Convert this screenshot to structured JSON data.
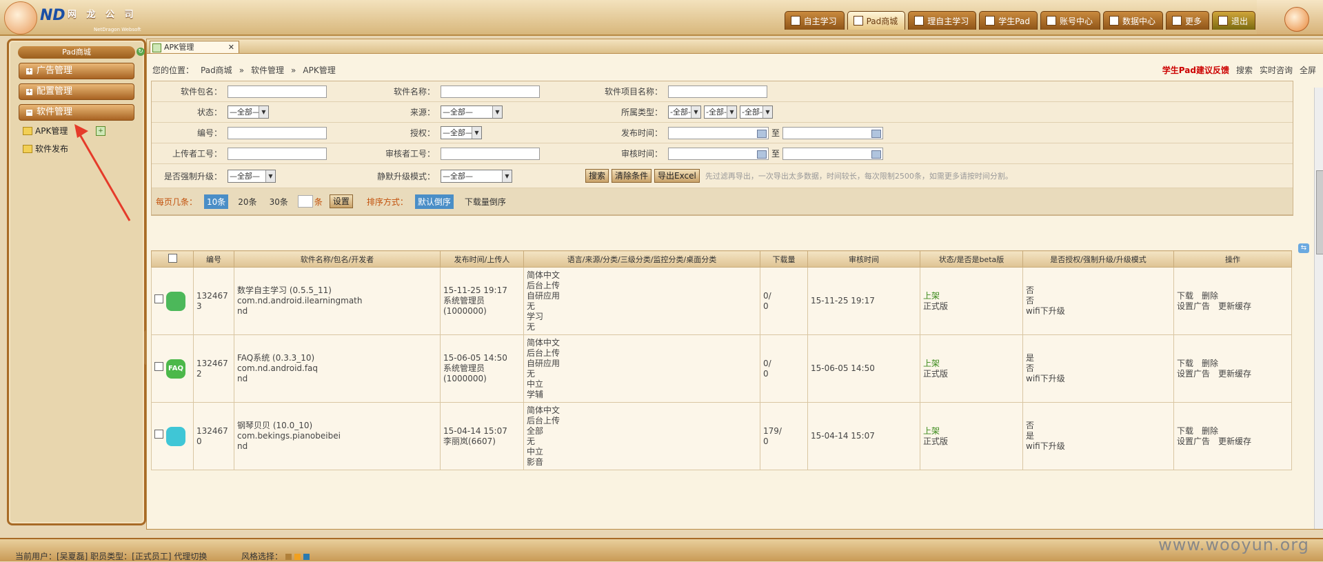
{
  "logo": {
    "cname": "网 龙 公 司",
    "sub": "NetDragon Websoft Inc"
  },
  "topnav": [
    {
      "label": "自主学习",
      "icon": "book-icon"
    },
    {
      "label": "Pad商城",
      "icon": "store-icon",
      "active": true
    },
    {
      "label": "理自主学习",
      "icon": "book-icon"
    },
    {
      "label": "学生Pad",
      "icon": "pad-icon"
    },
    {
      "label": "账号中心",
      "icon": "account-icon"
    },
    {
      "label": "数据中心",
      "icon": "data-icon"
    },
    {
      "label": "更多",
      "icon": "more-icon"
    },
    {
      "label": "退出",
      "icon": "exit-icon"
    }
  ],
  "sidebar": {
    "title": "Pad商城",
    "groups": [
      {
        "label": "广告管理",
        "toggle": "+"
      },
      {
        "label": "配置管理",
        "toggle": "+"
      },
      {
        "label": "软件管理",
        "toggle": "−"
      }
    ],
    "items": [
      {
        "label": "APK管理"
      },
      {
        "label": "软件发布"
      }
    ]
  },
  "tab": {
    "label": "APK管理",
    "close": "✕"
  },
  "breadcrumb": {
    "prefix": "您的位置：",
    "a": "Pad商城",
    "sep": "»",
    "b": "软件管理",
    "c": "APK管理"
  },
  "toplinks": {
    "feedback": "学生Pad建议反馈",
    "search": "搜索",
    "consult": "实时咨询",
    "full": "全屏"
  },
  "filter": {
    "pkg": "软件包名：",
    "name": "软件名称：",
    "proj": "软件项目名称：",
    "status": "状态：",
    "source": "来源：",
    "type": "所属类型：",
    "code": "编号：",
    "auth": "授权：",
    "pub": "发布时间：",
    "uploader": "上传者工号：",
    "auditor": "审核者工号：",
    "audit_time": "审核时间：",
    "force": "是否强制升级：",
    "silent": "静默升级模式：",
    "all": "—全部—",
    "all2": "-全部-",
    "to": "至",
    "btn_search": "搜索",
    "btn_clear": "清除条件",
    "btn_export": "导出Excel",
    "hint": "先过滤再导出，一次导出太多数据，时间较长，每次限制2500条，如需更多请按时间分割。"
  },
  "pager": {
    "label": "每页几条：",
    "o10": "10条",
    "o20": "20条",
    "o30": "30条",
    "unit": "条",
    "set": "设置",
    "sort": "排序方式：",
    "sort_default": "默认倒序",
    "sort_dl": "下载量倒序"
  },
  "table": {
    "headers": [
      "编号",
      "软件名称/包名/开发者",
      "发布时间/上传人",
      "语言/来源/分类/三级分类/监控分类/桌面分类",
      "下载量",
      "审核时间",
      "状态/是否是beta版",
      "是否授权/强制升级/升级模式",
      "操作"
    ],
    "rows": [
      {
        "id": "1324673",
        "name": "数学自主学习 (0.5.5_11)",
        "pkg": "com.nd.android.ilearningmath",
        "dev": "nd",
        "pub": "15-11-25 19:17",
        "uploader": "系统管理员(1000000)",
        "cat": [
          "简体中文",
          "后台上传",
          "自研应用",
          "无",
          "学习",
          "无"
        ],
        "dl": "0/",
        "dl2": "0",
        "audit": "15-11-25 19:17",
        "status": "上架",
        "beta": "正式版",
        "a1": "否",
        "a2": "否",
        "a3": "wifi下升级",
        "op1": "下载",
        "op2": "删除",
        "op3": "设置广告",
        "op4": "更新缓存",
        "iconText": "",
        "iconColor": "#4cb85a"
      },
      {
        "id": "1324672",
        "name": "FAQ系统 (0.3.3_10)",
        "pkg": "com.nd.android.faq",
        "dev": "nd",
        "pub": "15-06-05 14:50",
        "uploader": "系统管理员(1000000)",
        "cat": [
          "简体中文",
          "后台上传",
          "自研应用",
          "无",
          "中立",
          "学辅"
        ],
        "dl": "0/",
        "dl2": "0",
        "audit": "15-06-05 14:50",
        "status": "上架",
        "beta": "正式版",
        "a1": "是",
        "a2": "否",
        "a3": "wifi下升级",
        "op1": "下载",
        "op2": "删除",
        "op3": "设置广告",
        "op4": "更新缓存",
        "iconText": "FAQ",
        "iconColor": "#4cb84a"
      },
      {
        "id": "1324670",
        "name": "钢琴贝贝 (10.0_10)",
        "pkg": "com.bekings.pianobeibei",
        "dev": "nd",
        "pub": "15-04-14 15:07",
        "uploader": "李丽岚(6607)",
        "cat": [
          "简体中文",
          "后台上传",
          "全部",
          "无",
          "中立",
          "影音"
        ],
        "dl": "179/",
        "dl2": "0",
        "audit": "15-04-14 15:07",
        "status": "上架",
        "beta": "正式版",
        "a1": "否",
        "a2": "是",
        "a3": "wifi下升级",
        "op1": "下载",
        "op2": "删除",
        "op3": "设置广告",
        "op4": "更新缓存",
        "iconText": "",
        "iconColor": "#3fc6d6"
      }
    ]
  },
  "footer": {
    "user": "当前用户：[吴夏磊] 职员类型：[正式员工] 代理切换",
    "skin": "风格选择：",
    "watermark": "www.wooyun.org"
  },
  "colors": {
    "accent": "#a86a26",
    "select_blue": "#4a8ec7",
    "status_green": "#3a8a1a",
    "feedback_red": "#cc0000"
  }
}
